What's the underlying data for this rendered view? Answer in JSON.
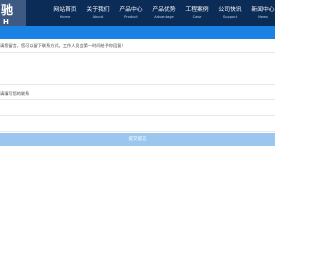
{
  "logo": {
    "char": "驰",
    "sub": "H"
  },
  "nav": [
    {
      "label": "网站首页",
      "sub": "Home"
    },
    {
      "label": "关于我们",
      "sub": "About"
    },
    {
      "label": "产品中心",
      "sub": "Product"
    },
    {
      "label": "产品优势",
      "sub": "Advantage"
    },
    {
      "label": "工程案例",
      "sub": "Case"
    },
    {
      "label": "公司快讯",
      "sub": "Support"
    },
    {
      "label": "新闻中心",
      "sub": "News"
    }
  ],
  "form": {
    "hint": "请您留言，您可以留下联系方式，工作人员会第一时间给予你回复！",
    "label2": "请填写您的联系",
    "submit_label": "提交留言"
  }
}
